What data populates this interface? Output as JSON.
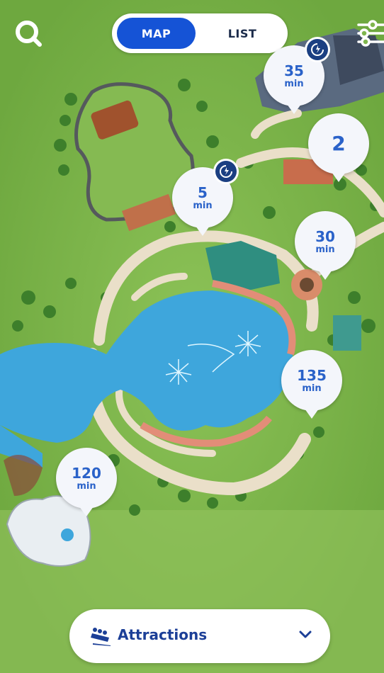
{
  "header": {
    "tabs": [
      {
        "label": "MAP",
        "active": true
      },
      {
        "label": "LIST",
        "active": false
      }
    ],
    "search_icon": "search-icon",
    "filter_icon": "filter-sliders-icon"
  },
  "pins": [
    {
      "number": "35",
      "unit": "min",
      "badge": "lightning-lane-icon"
    },
    {
      "number": "2",
      "unit": ""
    },
    {
      "number": "5",
      "unit": "min",
      "badge": "lightning-lane-icon"
    },
    {
      "number": "30",
      "unit": "min"
    },
    {
      "number": "135",
      "unit": "min"
    },
    {
      "number": "120",
      "unit": "min"
    }
  ],
  "category_selector": {
    "icon": "rollercoaster-icon",
    "label": "Attractions",
    "chevron": "chevron-down-icon"
  },
  "colors": {
    "accent": "#1553d6",
    "pin_text": "#2a62c9",
    "grass": "#7fb64d",
    "water": "#3ea6dc",
    "path": "#eadfc9"
  }
}
